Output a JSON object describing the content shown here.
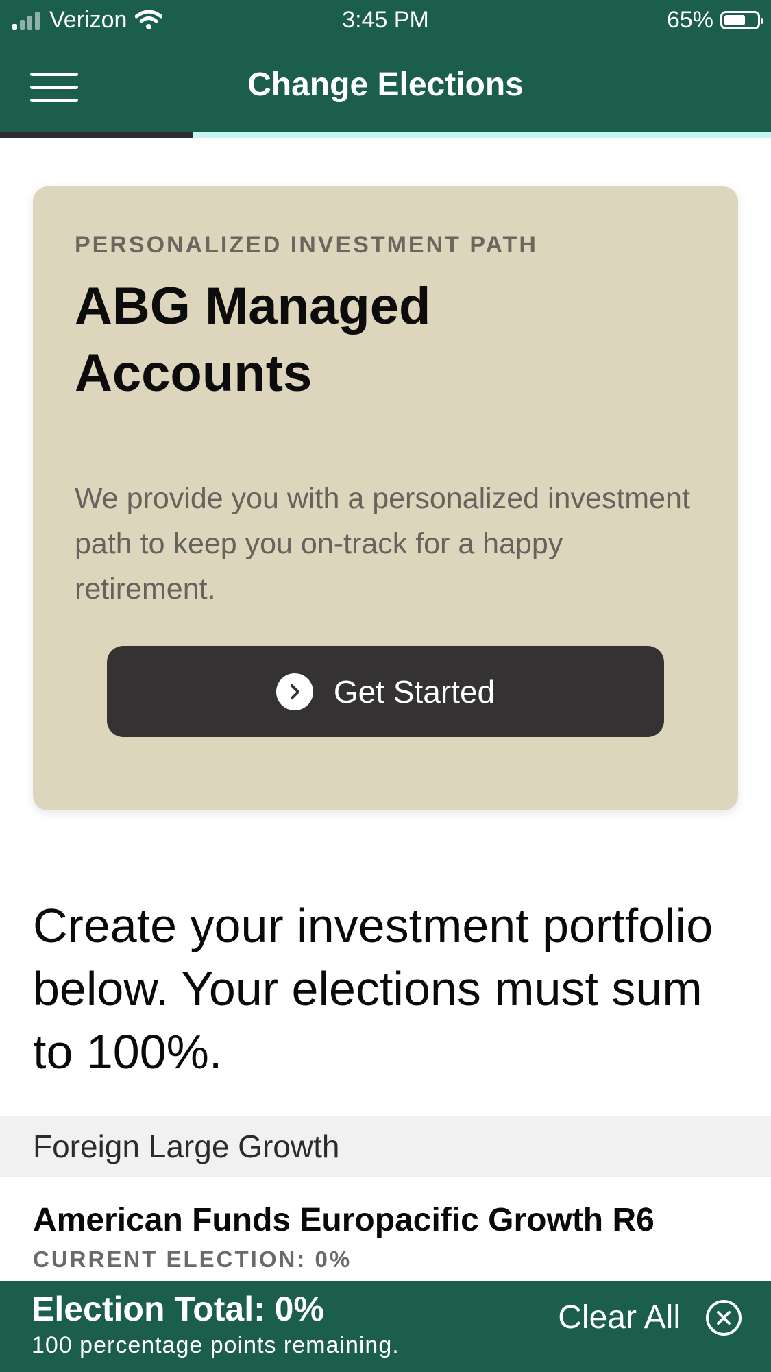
{
  "status_bar": {
    "carrier": "Verizon",
    "time": "3:45 PM",
    "battery_text": "65%",
    "battery_level": 0.65
  },
  "header": {
    "title": "Change Elections",
    "progress_fraction": 0.25,
    "menu_icon": "hamburger-menu-icon"
  },
  "card": {
    "eyebrow": "PERSONALIZED INVESTMENT PATH",
    "title": "ABG Managed Accounts",
    "description": "We provide you with a personalized investment path to keep you on-track for a happy retirement.",
    "button_label": "Get Started",
    "button_icon": "chevron-right-circle-icon"
  },
  "intro_text": "Create your investment portfolio below. Your elections must sum to 100%.",
  "section": {
    "label": "Foreign Large Growth"
  },
  "fund": {
    "name": "American Funds Europacific Growth R6",
    "current_election": "CURRENT ELECTION: 0%"
  },
  "bottom_bar": {
    "total_label": "Election Total: 0%",
    "remaining_text": "100 percentage points remaining.",
    "clear_label": "Clear All",
    "clear_icon": "close-circle-icon"
  },
  "colors": {
    "header_green": "#1b5e4c",
    "card_beige": "#ddd5bc",
    "button_dark": "#343233",
    "progress_track": "#c6f5f0"
  }
}
